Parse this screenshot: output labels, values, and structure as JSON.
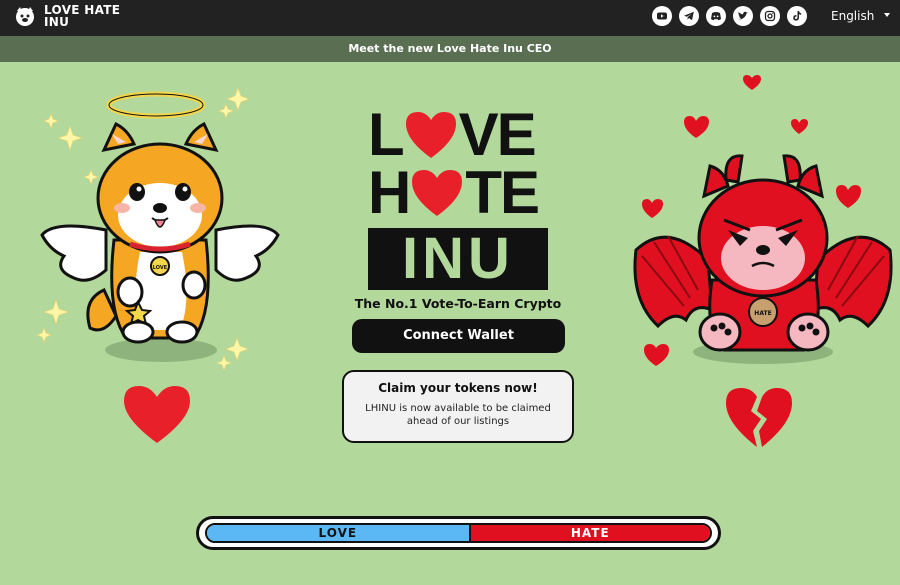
{
  "nav": {
    "brand_line1": "LOVE HATE",
    "brand_line2": "INU",
    "socials": [
      "youtube-icon",
      "telegram-icon",
      "discord-icon",
      "twitter-icon",
      "instagram-icon",
      "tiktok-icon"
    ],
    "language": "English"
  },
  "announcement": "Meet the new Love Hate Inu CEO",
  "logo": {
    "row1_left": "L",
    "row1_right": "VE",
    "row2_left": "H",
    "row2_right": "TE",
    "row3": "INU"
  },
  "tagline": "The No.1 Vote-To-Earn Crypto",
  "connect_label": "Connect Wallet",
  "claim": {
    "title": "Claim your tokens now!",
    "text": "LHINU is now available to be claimed ahead of our listings"
  },
  "vote": {
    "love_label": "LOVE",
    "hate_label": "HATE",
    "love_share": 0.52
  },
  "badges": {
    "angel": "LOVE",
    "devil": "HATE"
  },
  "colors": {
    "background": "#b3d89c",
    "nav": "#222222",
    "announcement": "#5a6e52",
    "love": "#5bb8f5",
    "hate": "#e01020",
    "heart": "#e8202a"
  }
}
